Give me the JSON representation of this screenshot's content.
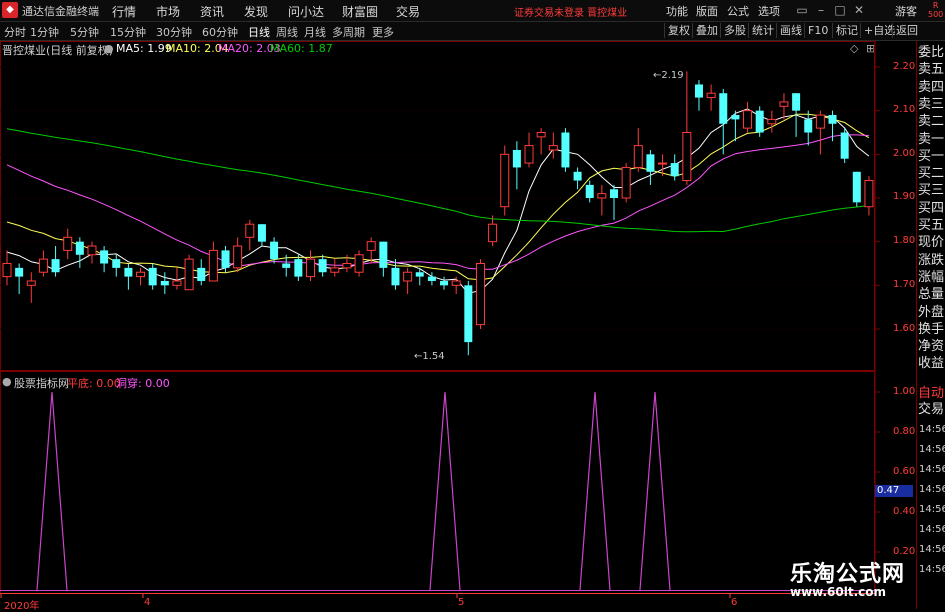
{
  "titlebar": {
    "app_name": "通达信金融终端",
    "menus": [
      "行情",
      "市场",
      "资讯",
      "发现",
      "问小达",
      "财富圈",
      "交易"
    ],
    "warning": "证券交易未登录  晋控煤业",
    "tools": [
      "功能",
      "版面",
      "公式",
      "选项"
    ],
    "guest": "游客",
    "corner_badge": "R\n500"
  },
  "periods": [
    "分时",
    "1分钟",
    "5分钟",
    "15分钟",
    "30分钟",
    "60分钟",
    "日线",
    "周线",
    "月线",
    "多周期",
    "更多"
  ],
  "active_period": "日线",
  "toolbar_right": [
    "复权",
    "叠加",
    "多股",
    "统计",
    "画线",
    "F10",
    "标记",
    "+自选",
    "返回"
  ],
  "main_chart": {
    "stock": "晋控煤业(日线 前复权)",
    "ma5": "MA5: 1.99",
    "ma10": "MA10: 2.04",
    "ma20": "MA20: 2.03",
    "ma60": "MA60: 1.87",
    "high_label": "2.19",
    "low_label": "1.54",
    "y_ticks": [
      "2.20",
      "2.10",
      "2.00",
      "1.90",
      "1.80",
      "1.70",
      "1.60"
    ]
  },
  "sub_chart": {
    "name": "股票指标网",
    "pingdi": "平底: 0.00",
    "dongchuan": "洞穿: 0.00",
    "y_ticks": [
      "1.00",
      "0.80",
      "0.60",
      "0.40",
      "0.20"
    ],
    "current": "0.47"
  },
  "x_labels": [
    "2020年",
    "4",
    "5",
    "6"
  ],
  "quote_panel": [
    "委比",
    "卖五",
    "卖四",
    "卖三",
    "卖二",
    "卖一",
    "买一",
    "买二",
    "买三",
    "买四",
    "买五",
    "现价",
    "涨跌",
    "涨幅",
    "总量",
    "外盘",
    "换手",
    "净资",
    "收益"
  ],
  "trade_panel": [
    "自动",
    "交易"
  ],
  "trade_times": [
    "14:56",
    "14:56",
    "14:56",
    "14:56",
    "14:56",
    "14:56",
    "14:56",
    "14:56"
  ],
  "watermark": {
    "title": "乐淘公式网",
    "url": "www.60lt.com"
  },
  "colors": {
    "up": "#ff3b3b",
    "down": "#54ffff",
    "ma5": "#ffffff",
    "ma10": "#ffff55",
    "ma20": "#ff55ff",
    "ma60": "#00cc00",
    "signal": "#cc44cc"
  }
}
